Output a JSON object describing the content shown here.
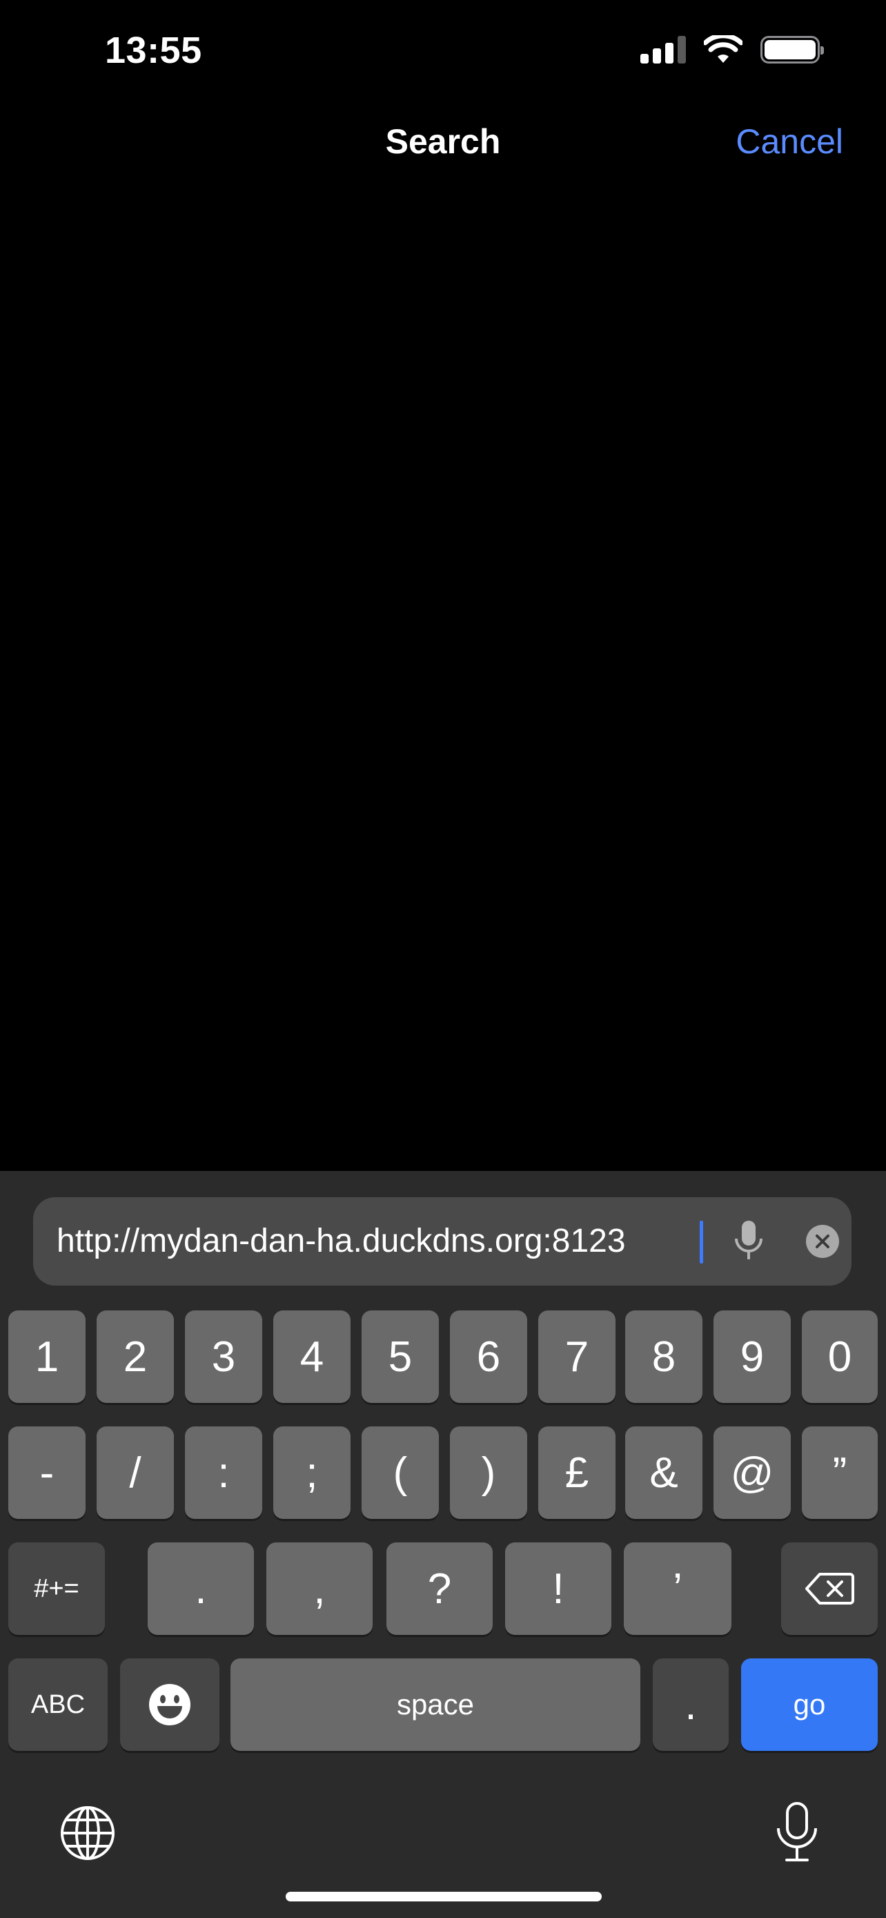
{
  "status_bar": {
    "time": "13:55"
  },
  "nav": {
    "title": "Search",
    "cancel_label": "Cancel"
  },
  "search": {
    "value": "http://mydan-dan-ha.duckdns.org:8123",
    "mic_icon": "microphone-icon",
    "clear_icon": "clear-circle-icon"
  },
  "keyboard": {
    "row1": [
      "1",
      "2",
      "3",
      "4",
      "5",
      "6",
      "7",
      "8",
      "9",
      "0"
    ],
    "row2": [
      "-",
      "/",
      ":",
      ";",
      "(",
      ")",
      "£",
      "&",
      "@",
      "”"
    ],
    "row3": {
      "toggle": "#+=",
      "keys": [
        ".",
        ",",
        "?",
        "!",
        "’"
      ],
      "delete_icon": "backspace-icon"
    },
    "row4": {
      "abc": "ABC",
      "emoji_icon": "emoji-icon",
      "space": "space",
      "dot": ".",
      "go": "go"
    },
    "bottom": {
      "globe_icon": "globe-icon",
      "dictation_icon": "microphone-icon"
    }
  },
  "colors": {
    "accent": "#5b8cff",
    "go_key": "#3478f6",
    "caret": "#3d7bff"
  }
}
